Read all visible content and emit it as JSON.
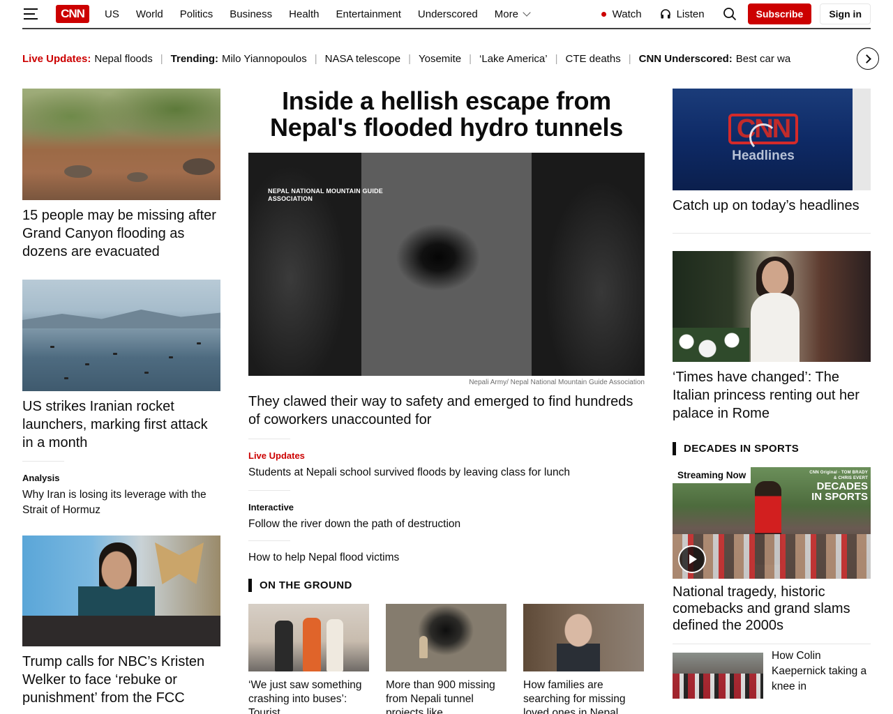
{
  "header": {
    "logo": "CNN",
    "nav": [
      "US",
      "World",
      "Politics",
      "Business",
      "Health",
      "Entertainment",
      "Underscored"
    ],
    "more": "More",
    "watch": "Watch",
    "listen": "Listen",
    "subscribe": "Subscribe",
    "sign_in": "Sign in",
    "accent": "#cc0000"
  },
  "trending": {
    "live_label": "Live Updates:",
    "live_text": "Nepal floods",
    "trending_label": "Trending:",
    "trending_first": "Milo Yiannopoulos",
    "items": [
      "NASA telescope",
      "Yosemite",
      "‘Lake America’",
      "CTE deaths"
    ],
    "underscored_label": "CNN Underscored:",
    "underscored_text": "Best car wa"
  },
  "left": {
    "story1": "15 people may be missing after Grand Canyon flooding as dozens are evacuated",
    "story2": "US strikes Iranian rocket launchers, marking first attack in a month",
    "analysis_label": "Analysis",
    "analysis_text": "Why Iran is losing its leverage with the Strait of Hormuz",
    "story3": "Trump calls for NBC’s Kristen Welker to face ‘rebuke or punishment’ from the FCC"
  },
  "main": {
    "title": "Inside a hellish escape from Nepal's flooded hydro tunnels",
    "watermark": "NEPAL NATIONAL MOUNTAIN GUIDE ASSOCIATION",
    "credit": "Nepali Army/ Nepal National Mountain Guide Association",
    "headline": "They clawed their way to safety and emerged to find hundreds of coworkers unaccounted for",
    "live_label": "Live Updates",
    "live_text": "Students at Nepali school survived floods by leaving class for lunch",
    "interactive_label": "Interactive",
    "interactive_text": "Follow the river down the path of destruction",
    "help_text": "How to help Nepal flood victims",
    "section": "ON THE GROUND",
    "cards": [
      "‘We just saw something crashing into buses’: Tourist",
      "More than 900 missing from Nepali tunnel projects like",
      "How families are searching for missing loved ones in Nepal"
    ]
  },
  "right": {
    "headlines_logo": "CNN",
    "headlines_sub": "Headlines",
    "headlines_caption": "Catch up on today’s headlines",
    "princess": "‘Times have changed’: The Italian princess renting out her palace in Rome",
    "section": "DECADES IN SPORTS",
    "streaming_badge": "Streaming Now",
    "sports_logo_top": "CNN Original · TOM BRADY & CHRIS EVERT",
    "sports_logo": "DECADES",
    "sports_logo_sub": "IN SPORTS",
    "sports_headline": "National tragedy, historic comebacks and grand slams defined the 2000s",
    "mini_caption": "How Colin Kaepernick taking a knee in"
  }
}
